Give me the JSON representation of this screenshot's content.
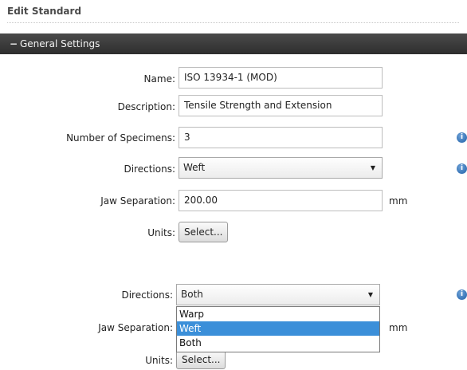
{
  "page": {
    "title": "Edit Standard"
  },
  "section": {
    "toggle": "−",
    "title": "General Settings"
  },
  "form": {
    "name": {
      "label": "Name:",
      "value": "ISO 13934-1 (MOD)"
    },
    "description": {
      "label": "Description:",
      "value": "Tensile Strength and Extension"
    },
    "specimens": {
      "label": "Number of Specimens:",
      "value": "3"
    },
    "directions": {
      "label": "Directions:",
      "value": "Weft"
    },
    "jaw": {
      "label": "Jaw Separation:",
      "value": "200.00",
      "unit": "mm"
    },
    "units": {
      "label": "Units:",
      "button": "Select..."
    }
  },
  "form2": {
    "directions": {
      "label": "Directions:",
      "value": "Both"
    },
    "jaw": {
      "label": "Jaw Separation:",
      "unit": "mm"
    },
    "units": {
      "label": "Units:",
      "button": "Select..."
    },
    "options": [
      "Warp",
      "Weft",
      "Both"
    ],
    "highlighted": "Weft"
  },
  "icons": {
    "info": "info-icon",
    "caret": "chevron-down-icon"
  },
  "colors": {
    "header_bg": "#2e2e2e",
    "highlight": "#3b8fd9",
    "info": "#1f5fa8"
  }
}
